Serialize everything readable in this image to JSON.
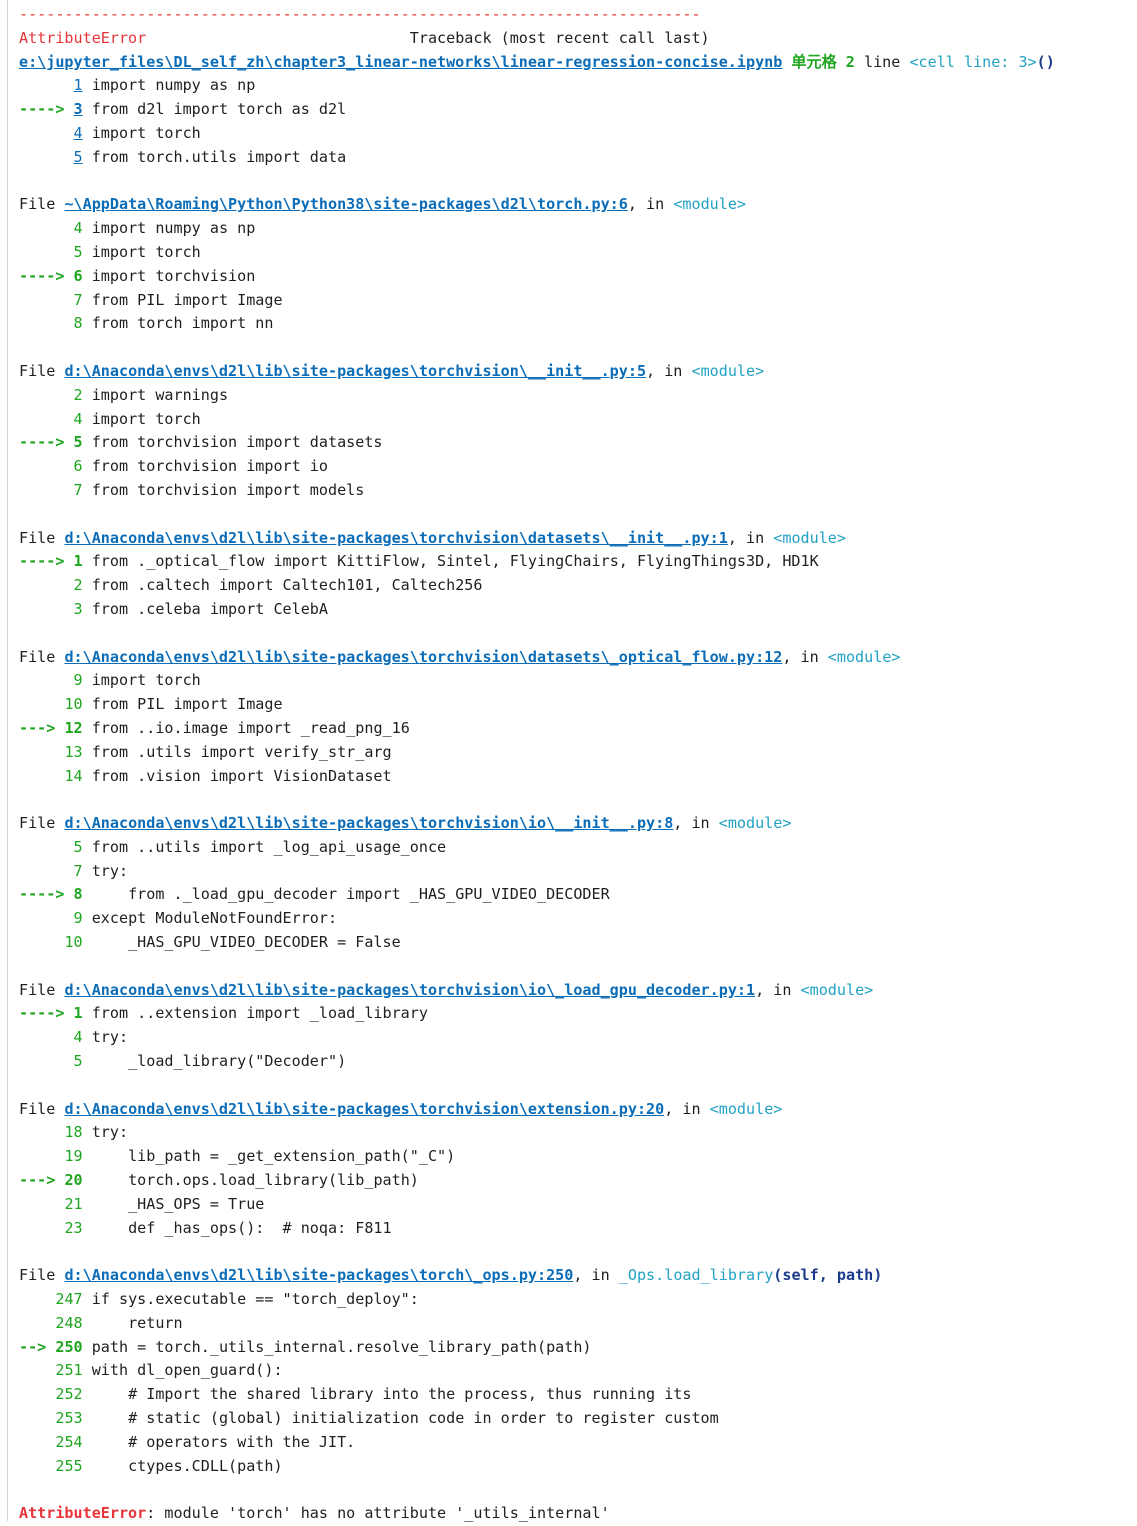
{
  "traceback": {
    "dashes": "---------------------------------------------------------------------------",
    "error_name": "AttributeError",
    "header_gap": "                             ",
    "header_text": "Traceback (most recent call last)",
    "cell": {
      "path": "e:\\jupyter_files\\DL_self_zh\\chapter3_linear-networks\\linear-regression-concise.ipynb",
      "cell_label": "单元格 2",
      "line_word": "line",
      "where": "<cell line: 3>",
      "call": "()"
    },
    "frames": [
      {
        "kind": "cell",
        "lines": [
          {
            "num": "1",
            "code": "import numpy as np",
            "arrow": ""
          },
          {
            "num": "3",
            "code": "from d2l import torch as d2l",
            "arrow": "---->"
          },
          {
            "num": "4",
            "code": "import torch",
            "arrow": ""
          },
          {
            "num": "5",
            "code": "from torch.utils import data",
            "arrow": ""
          }
        ]
      },
      {
        "file_label": "File",
        "path": "~\\AppData\\Roaming\\Python\\Python38\\site-packages\\d2l\\torch.py:6",
        "in_label": ", in",
        "where": "<module>",
        "lines": [
          {
            "num": "4",
            "code": "import numpy as np",
            "arrow": ""
          },
          {
            "num": "5",
            "code": "import torch",
            "arrow": ""
          },
          {
            "num": "6",
            "code": "import torchvision",
            "arrow": "---->"
          },
          {
            "num": "7",
            "code": "from PIL import Image",
            "arrow": ""
          },
          {
            "num": "8",
            "code": "from torch import nn",
            "arrow": ""
          }
        ]
      },
      {
        "file_label": "File",
        "path": "d:\\Anaconda\\envs\\d2l\\lib\\site-packages\\torchvision\\__init__.py:5",
        "in_label": ", in",
        "where": "<module>",
        "lines": [
          {
            "num": "2",
            "code": "import warnings",
            "arrow": ""
          },
          {
            "num": "4",
            "code": "import torch",
            "arrow": ""
          },
          {
            "num": "5",
            "code": "from torchvision import datasets",
            "arrow": "---->"
          },
          {
            "num": "6",
            "code": "from torchvision import io",
            "arrow": ""
          },
          {
            "num": "7",
            "code": "from torchvision import models",
            "arrow": ""
          }
        ]
      },
      {
        "file_label": "File",
        "path": "d:\\Anaconda\\envs\\d2l\\lib\\site-packages\\torchvision\\datasets\\__init__.py:1",
        "in_label": ", in",
        "where": "<module>",
        "lines": [
          {
            "num": "1",
            "code": "from ._optical_flow import KittiFlow, Sintel, FlyingChairs, FlyingThings3D, HD1K",
            "arrow": "---->"
          },
          {
            "num": "2",
            "code": "from .caltech import Caltech101, Caltech256",
            "arrow": ""
          },
          {
            "num": "3",
            "code": "from .celeba import CelebA",
            "arrow": ""
          }
        ]
      },
      {
        "file_label": "File",
        "path": "d:\\Anaconda\\envs\\d2l\\lib\\site-packages\\torchvision\\datasets\\_optical_flow.py:12",
        "in_label": ", in",
        "where": "<module>",
        "lines": [
          {
            "num": "9",
            "code": "import torch",
            "arrow": ""
          },
          {
            "num": "10",
            "code": "from PIL import Image",
            "arrow": ""
          },
          {
            "num": "12",
            "code": "from ..io.image import _read_png_16",
            "arrow": "--->"
          },
          {
            "num": "13",
            "code": "from .utils import verify_str_arg",
            "arrow": ""
          },
          {
            "num": "14",
            "code": "from .vision import VisionDataset",
            "arrow": ""
          }
        ]
      },
      {
        "file_label": "File",
        "path": "d:\\Anaconda\\envs\\d2l\\lib\\site-packages\\torchvision\\io\\__init__.py:8",
        "in_label": ", in",
        "where": "<module>",
        "lines": [
          {
            "num": "5",
            "code": "from ..utils import _log_api_usage_once",
            "arrow": ""
          },
          {
            "num": "7",
            "code": "try:",
            "arrow": ""
          },
          {
            "num": "8",
            "code": "    from ._load_gpu_decoder import _HAS_GPU_VIDEO_DECODER",
            "arrow": "---->"
          },
          {
            "num": "9",
            "code": "except ModuleNotFoundError:",
            "arrow": ""
          },
          {
            "num": "10",
            "code": "    _HAS_GPU_VIDEO_DECODER = False",
            "arrow": ""
          }
        ]
      },
      {
        "file_label": "File",
        "path": "d:\\Anaconda\\envs\\d2l\\lib\\site-packages\\torchvision\\io\\_load_gpu_decoder.py:1",
        "in_label": ", in",
        "where": "<module>",
        "lines": [
          {
            "num": "1",
            "code": "from ..extension import _load_library",
            "arrow": "---->"
          },
          {
            "num": "4",
            "code": "try:",
            "arrow": ""
          },
          {
            "num": "5",
            "code": "    _load_library(\"Decoder\")",
            "arrow": ""
          }
        ]
      },
      {
        "file_label": "File",
        "path": "d:\\Anaconda\\envs\\d2l\\lib\\site-packages\\torchvision\\extension.py:20",
        "in_label": ", in",
        "where": "<module>",
        "lines": [
          {
            "num": "18",
            "code": "try:",
            "arrow": ""
          },
          {
            "num": "19",
            "code": "    lib_path = _get_extension_path(\"_C\")",
            "arrow": ""
          },
          {
            "num": "20",
            "code": "    torch.ops.load_library(lib_path)",
            "arrow": "--->"
          },
          {
            "num": "21",
            "code": "    _HAS_OPS = True",
            "arrow": ""
          },
          {
            "num": "23",
            "code": "    def _has_ops():  # noqa: F811",
            "arrow": ""
          }
        ]
      },
      {
        "file_label": "File",
        "path": "d:\\Anaconda\\envs\\d2l\\lib\\site-packages\\torch\\_ops.py:250",
        "in_label": ", in",
        "where": "_Ops.load_library",
        "args": "(self, path)",
        "lines": [
          {
            "num": "247",
            "code": "if sys.executable == \"torch_deploy\":",
            "arrow": ""
          },
          {
            "num": "248",
            "code": "    return",
            "arrow": ""
          },
          {
            "num": "250",
            "code": "path = torch._utils_internal.resolve_library_path(path)",
            "arrow": "-->"
          },
          {
            "num": "251",
            "code": "with dl_open_guard():",
            "arrow": ""
          },
          {
            "num": "252",
            "code": "    # Import the shared library into the process, thus running its",
            "arrow": ""
          },
          {
            "num": "253",
            "code": "    # static (global) initialization code in order to register custom",
            "arrow": ""
          },
          {
            "num": "254",
            "code": "    # operators with the JIT.",
            "arrow": ""
          },
          {
            "num": "255",
            "code": "    ctypes.CDLL(path)",
            "arrow": ""
          }
        ]
      }
    ],
    "final_error": {
      "name": "AttributeError",
      "message": ": module 'torch' has no attribute '_utils_internal'"
    }
  }
}
